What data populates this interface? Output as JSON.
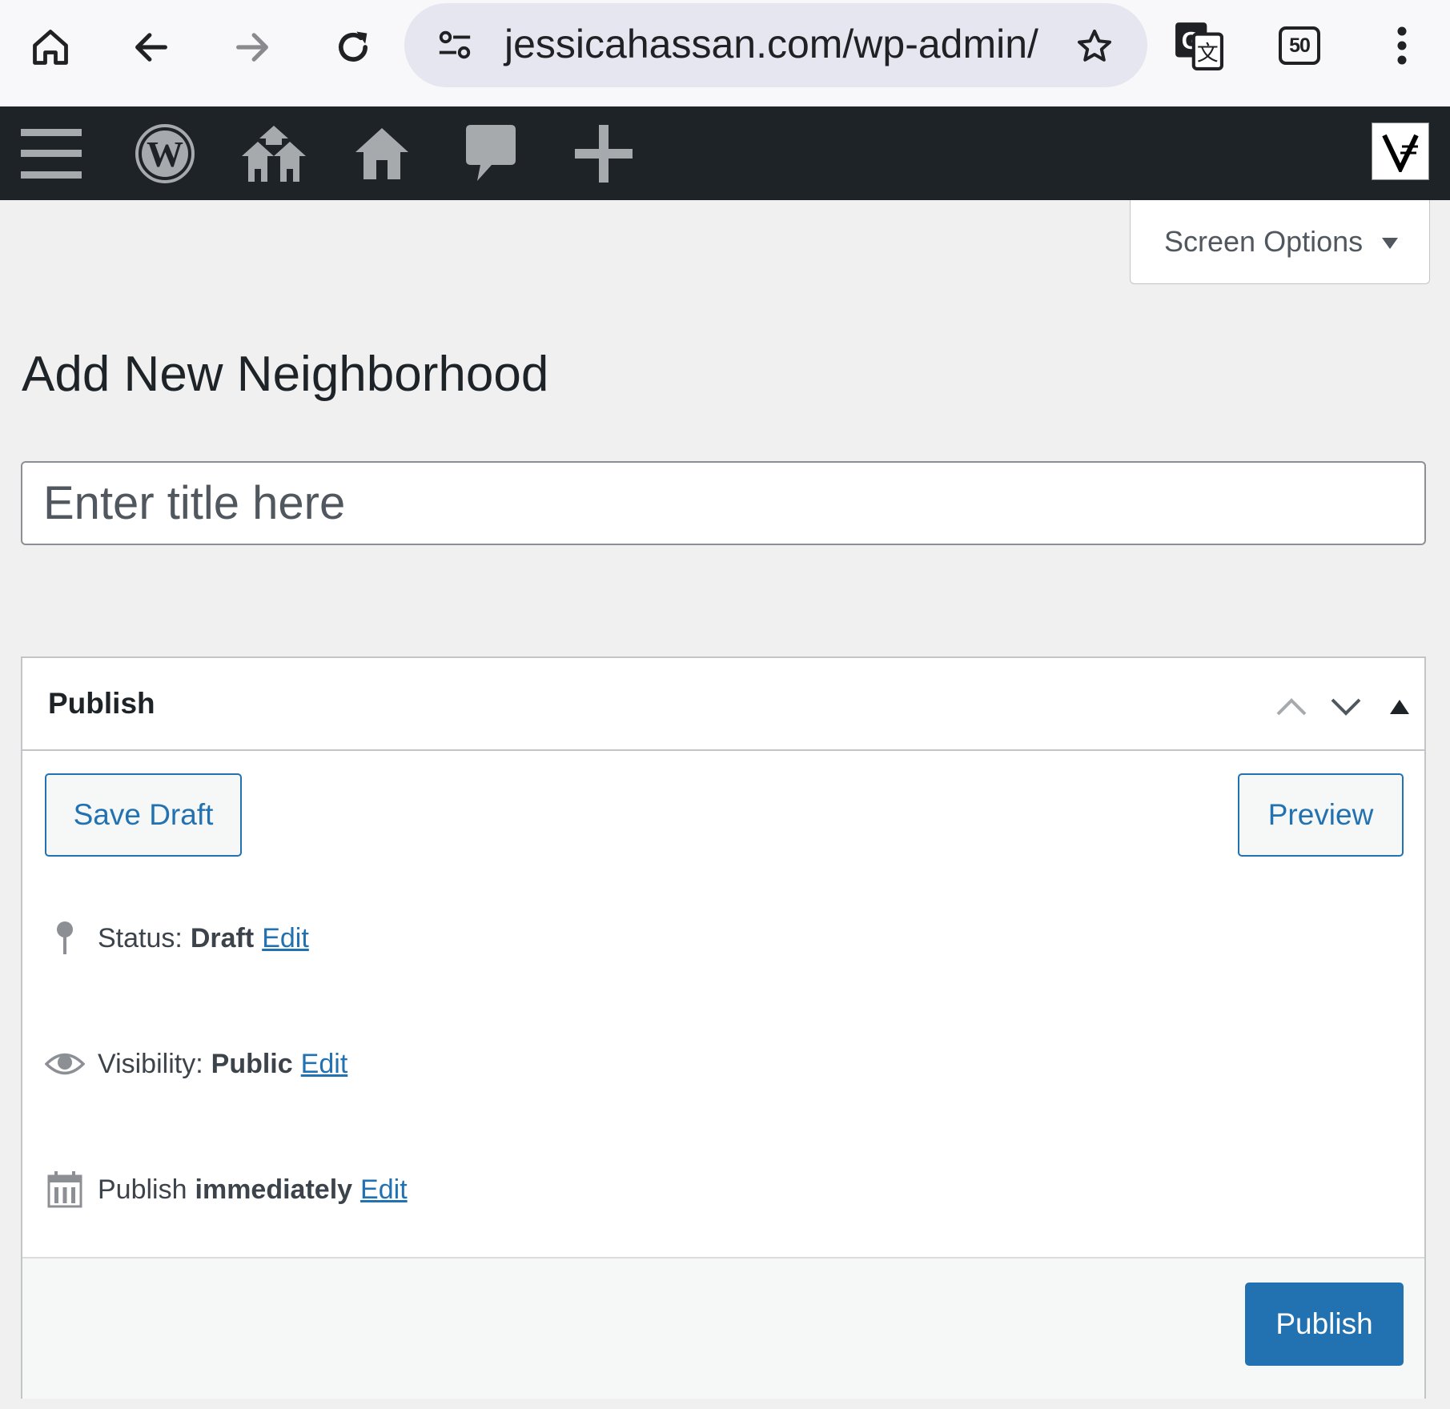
{
  "browser": {
    "url": "jessicahassan.com/wp-admin/",
    "tab_count": "50",
    "icons": [
      "home-icon",
      "back-icon",
      "forward-icon",
      "reload-icon",
      "site-info-icon",
      "bookmark-star-icon",
      "translate-icon",
      "tab-counter-icon",
      "menu-kebab-icon"
    ]
  },
  "admin_bar": {
    "icons": [
      "menu-icon",
      "wordpress-logo-icon",
      "my-sites-icon",
      "site-home-icon",
      "comments-icon",
      "new-content-icon",
      "account-avatar-icon"
    ]
  },
  "screen_options": {
    "label": "Screen Options"
  },
  "page": {
    "title": "Add New Neighborhood",
    "title_placeholder": "Enter title here"
  },
  "publish_box": {
    "heading": "Publish",
    "save_draft": "Save Draft",
    "preview": "Preview",
    "status_label": "Status:",
    "status_value": "Draft",
    "visibility_label": "Visibility:",
    "visibility_value": "Public",
    "schedule_label": "Publish",
    "schedule_value": "immediately",
    "edit_label": "Edit",
    "publish_button": "Publish"
  },
  "colors": {
    "admin_bar": "#1d2327",
    "accent": "#2271b1",
    "background": "#f0f0f1"
  }
}
